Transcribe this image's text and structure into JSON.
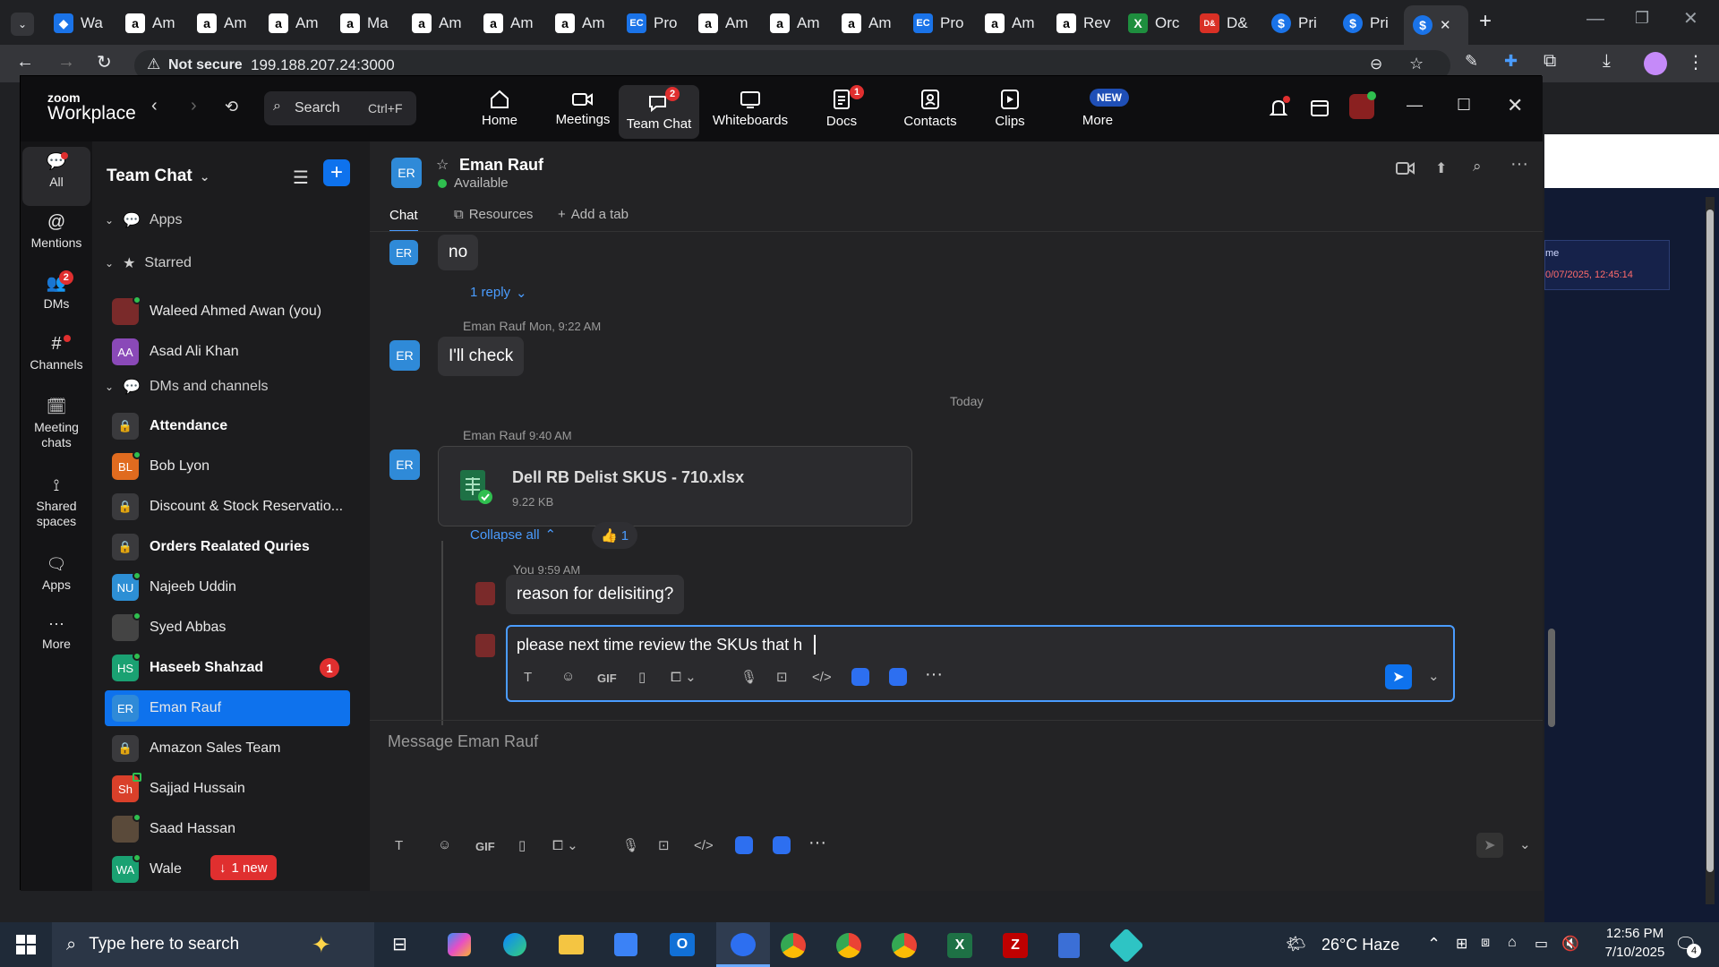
{
  "browser": {
    "tabs": [
      "Wa",
      "Am",
      "Am",
      "Am",
      "Ma",
      "Am",
      "Am",
      "Am",
      "Pro",
      "Am",
      "Am",
      "Am",
      "Pro",
      "Am",
      "Rev",
      "Orc",
      "D&",
      "Pri",
      "Pri"
    ],
    "address": {
      "security": "Not secure",
      "url": "199.188.207.24:3000"
    }
  },
  "backdrop": {
    "label": "me",
    "timestamp": "0/07/2025, 12:45:14"
  },
  "zoom": {
    "logo_top": "zoom",
    "logo_bottom": "Workplace",
    "search": {
      "label": "Search",
      "shortcut": "Ctrl+F"
    },
    "nav": [
      {
        "label": "Home"
      },
      {
        "label": "Meetings"
      },
      {
        "label": "Team Chat",
        "badge": "2"
      },
      {
        "label": "Whiteboards"
      },
      {
        "label": "Docs",
        "badge": "1"
      },
      {
        "label": "Contacts"
      },
      {
        "label": "Clips"
      },
      {
        "label": "More",
        "badge": "NEW"
      }
    ],
    "rail": [
      {
        "label": "All"
      },
      {
        "label": "Mentions"
      },
      {
        "label": "DMs",
        "badge": "2"
      },
      {
        "label": "Channels"
      },
      {
        "label": "Meeting chats"
      },
      {
        "label": "Shared spaces"
      },
      {
        "label": "Apps"
      },
      {
        "label": "More"
      }
    ],
    "sidebar": {
      "title": "Team Chat",
      "sections": [
        "Apps",
        "Starred",
        "DMs and channels"
      ],
      "starred": [
        {
          "name": "Waleed Ahmed Awan (you)"
        },
        {
          "name": "Asad Ali Khan",
          "initials": "AA"
        }
      ],
      "items": [
        {
          "name": "Attendance"
        },
        {
          "name": "Bob Lyon",
          "initials": "BL"
        },
        {
          "name": "Discount & Stock Reservatio..."
        },
        {
          "name": "Orders Realated Quries"
        },
        {
          "name": "Najeeb Uddin",
          "initials": "NU"
        },
        {
          "name": "Syed Abbas"
        },
        {
          "name": "Haseeb Shahzad",
          "initials": "HS",
          "badge": "1"
        },
        {
          "name": "Eman Rauf",
          "initials": "ER"
        },
        {
          "name": "Amazon Sales Team"
        },
        {
          "name": "Sajjad Hussain",
          "initials": "Sh"
        },
        {
          "name": "Saad Hassan"
        },
        {
          "name": "Wale",
          "initials": "WA"
        }
      ],
      "new_badge": "1 new"
    },
    "header": {
      "initials": "ER",
      "name": "Eman Rauf",
      "status": "Available",
      "tabs": [
        "Chat",
        "Resources",
        "Add a tab"
      ]
    },
    "messages": {
      "m1": "no",
      "reply": "1 reply",
      "m2_meta": "Eman Rauf",
      "m2_time": "Mon, 9:22 AM",
      "m2": "I'll check",
      "divider": "Today",
      "m3_meta": "Eman Rauf",
      "m3_time": "9:40 AM",
      "file": {
        "name": "Dell RB Delist SKUS - 710.xlsx",
        "size": "9.22 KB"
      },
      "collapse": "Collapse all",
      "reaction": "👍",
      "reaction_count": "1",
      "r1_meta": "You",
      "r1_time": "9:59 AM",
      "r1": "reason for delisiting?",
      "draft": "please next time review the SKUs that h"
    },
    "composer": {
      "placeholder": "Message Eman Rauf",
      "gif": "GIF"
    }
  },
  "taskbar": {
    "search": "Type here to search",
    "weather": "26°C  Haze",
    "time": "12:56 PM",
    "date": "7/10/2025",
    "notifications": "4"
  }
}
